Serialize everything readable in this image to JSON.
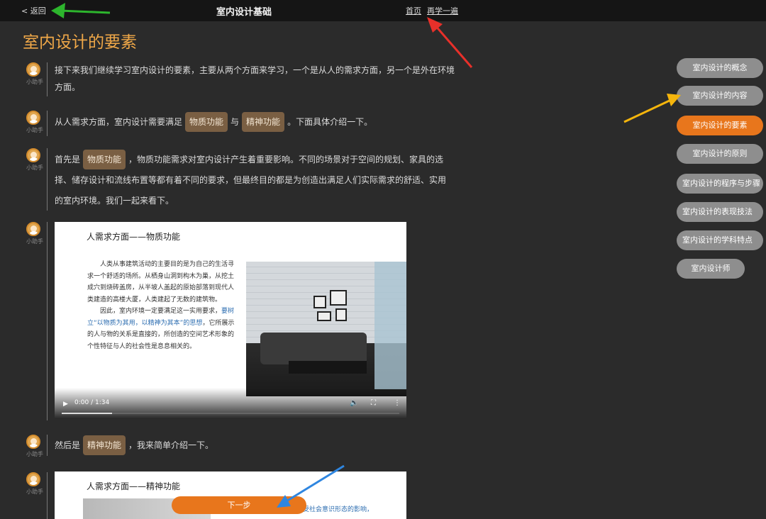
{
  "topbar": {
    "back": "< 返回",
    "title": "室内设计基础",
    "home": "首页",
    "relearn": "再学一遍"
  },
  "page_title": "室内设计的要素",
  "assistant_label": "小助手",
  "messages": {
    "m1": "接下来我们继续学习室内设计的要素，主要从两个方面来学习，一个是从人的需求方面，另一个是外在环境方面。",
    "m2_pre": "从人需求方面，室内设计需要满足",
    "m2_tag1": "物质功能",
    "m2_mid": "与",
    "m2_tag2": "精神功能",
    "m2_post": "。下面具体介绍一下。",
    "m3_pre": "首先是",
    "m3_tag": "物质功能",
    "m3_post": "，物质功能需求对室内设计产生着重要影响。不同的场景对于空间的规划、家具的选择、储存设计和流线布置等都有着不同的要求，但最终目的都是为创造出满足人们实际需求的舒适、实用的室内环境。我们一起来看下。",
    "m4_pre": "然后是",
    "m4_tag": "精神功能",
    "m4_post": "，我来简单介绍一下。"
  },
  "video1": {
    "title": "人需求方面——物质功能",
    "p1": "人类从事建筑活动的主要目的是为自己的生活寻求一个舒适的场所。从栖身山洞到构木为巢，从挖土成穴到烧砖盖房，从半坡人盖起的原始部落到现代人类建造的高楼大厦，人类建起了无数的建筑物。",
    "p2_pre": "因此，室内环境一定要满足这一实用要求，",
    "p2_hl": "要树立“以物质为其用，以精神为其本”的思想",
    "p2_post": "，它所展示的人与物的关系是直接的，所创造的空间艺术形象的个性特征与人的社会性是息息相关的。",
    "time": "0:00 / 1:34",
    "progress": 0.15
  },
  "video2": {
    "title": "人需求方面——精神功能",
    "text": "受社会意识形态的影响，"
  },
  "next_button": "下一步",
  "side_menu": [
    {
      "label": "室内设计的概念",
      "active": false
    },
    {
      "label": "室内设计的内容",
      "active": false
    },
    {
      "label": "室内设计的要素",
      "active": true
    },
    {
      "label": "室内设计的原则",
      "active": false
    },
    {
      "label": "室内设计的程序与步骤",
      "active": false
    },
    {
      "label": "室内设计的表现技法",
      "active": false
    },
    {
      "label": "室内设计的学科特点",
      "active": false
    },
    {
      "label": "室内设计师",
      "active": false
    }
  ],
  "colors": {
    "accent": "#e8761c",
    "heading": "#f0a848",
    "tag_bg": "#7a5f43",
    "arrow_green": "#2db52d",
    "arrow_red": "#e8302a",
    "arrow_yellow": "#f5b50c",
    "arrow_blue": "#2f86e0"
  },
  "icons": [
    "assistant-avatar-icon",
    "play-icon",
    "volume-icon",
    "fullscreen-icon",
    "more-icon"
  ]
}
